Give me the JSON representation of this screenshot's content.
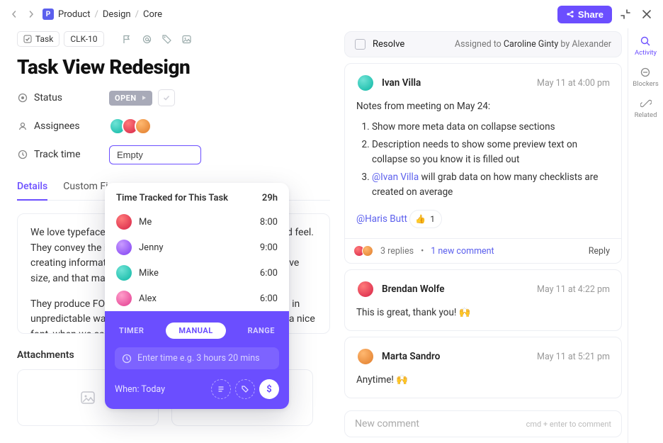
{
  "breadcrumbs": {
    "space_badge": "P",
    "a": "Product",
    "b": "Design",
    "c": "Core"
  },
  "share_label": "Share",
  "toolbar": {
    "task_label": "Task",
    "task_id": "CLK-10"
  },
  "title": "Task View Redesign",
  "meta": {
    "status_label": "Status",
    "status_value": "OPEN",
    "assignees_label": "Assignees",
    "track_label": "Track time",
    "track_value": "Empty"
  },
  "tabs": {
    "a": "Details",
    "b": "Custom Fie"
  },
  "description": {
    "p1": "We love typefaces. They give your site personality, tone, and feel. They convey the information beyond text, setting the tone, creating information hierarchy. But they're files, and files have size, and that makes sites slow.",
    "p2": "They produce FOUT or FOIT, which can move things around in unpredictable ways. Why should we bother with all that for a nice font, when we can just rely on the"
  },
  "attachments_title": "Attachments",
  "time_popup": {
    "title": "Time Tracked for This Task",
    "total": "29h",
    "rows": [
      {
        "name": "Me",
        "dur": "8:00"
      },
      {
        "name": "Jenny",
        "dur": "9:00"
      },
      {
        "name": "Mike",
        "dur": "6:00"
      },
      {
        "name": "Alex",
        "dur": "6:00"
      }
    ],
    "mode_timer": "TIMER",
    "mode_manual": "MANUAL",
    "mode_range": "RANGE",
    "placeholder": "Enter time e.g. 3 hours 20 mins",
    "when": "When: Today",
    "dollar": "$"
  },
  "resolve": {
    "label": "Resolve",
    "assigned_pre": "Assigned to ",
    "assignee": "Caroline Ginty",
    "by": " by Alexander"
  },
  "comments": [
    {
      "author": "Ivan Villa",
      "time": "May 11 at 4:00 pm",
      "lead": "Notes from meeting on May 24:",
      "li1": "Show more meta data on collapse sections",
      "li2": "Description needs to show some preview text on collapse so you know it is filled out",
      "li3a": "@Ivan Villa",
      "li3b": " will grab data on how many checklists are created on average",
      "tail": "@Haris Butt",
      "react_count": "1",
      "replies": "3 replies",
      "newc": "1 new comment",
      "reply": "Reply",
      "dot": "•"
    },
    {
      "author": "Brendan Wolfe",
      "time": "May 11 at 4:22 pm",
      "body": "This is great, thank you! 🙌"
    },
    {
      "author": "Marta Sandro",
      "time": "May 11 at 5:21 pm",
      "body": "Anytime! 🙌"
    }
  ],
  "new_comment": {
    "placeholder": "New comment",
    "hint": "cmd + enter to comment"
  },
  "rail": {
    "activity": "Activity",
    "blockers": "Blockers",
    "related": "Related"
  }
}
